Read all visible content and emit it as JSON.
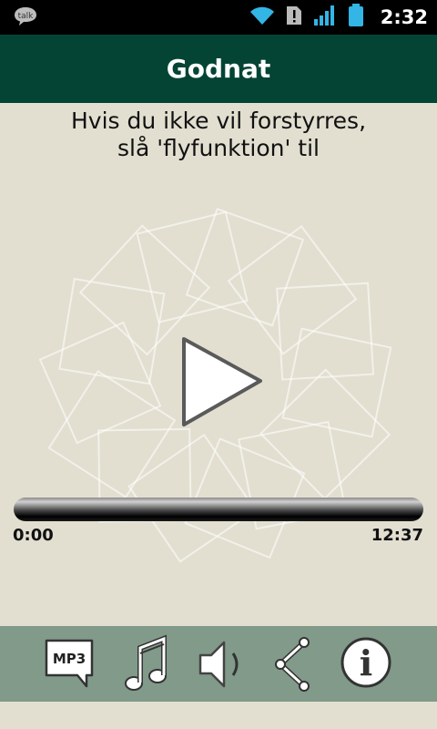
{
  "status_bar": {
    "notification_icon": "talk-icon",
    "notification_label": "talk",
    "time": "2:32",
    "icons": [
      "wifi-icon",
      "sd-card-alert-icon",
      "signal-icon",
      "battery-icon"
    ]
  },
  "header": {
    "title": "Godnat"
  },
  "message": {
    "line1": "Hvis du ikke vil forstyrres,",
    "line2": "slå 'flyfunktion' til"
  },
  "player": {
    "play_icon": "play-icon",
    "elapsed": "0:00",
    "duration": "12:37",
    "progress": 0
  },
  "toolbar": {
    "items": [
      {
        "icon": "mp3-icon",
        "label": "MP3"
      },
      {
        "icon": "music-note-icon"
      },
      {
        "icon": "speaker-icon"
      },
      {
        "icon": "share-icon"
      },
      {
        "icon": "info-icon",
        "label": "i"
      }
    ]
  },
  "colors": {
    "background": "#e2dfd1",
    "header": "#034434",
    "toolbar": "#819a8a",
    "statusbar": "#000000"
  }
}
